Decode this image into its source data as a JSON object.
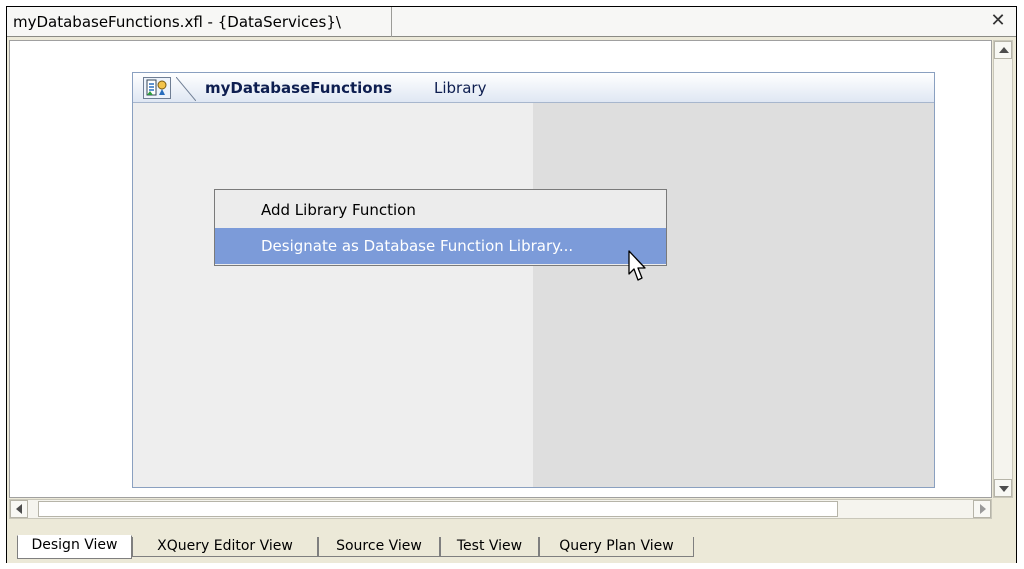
{
  "window": {
    "title": "myDatabaseFunctions.xfl - {DataServices}\\",
    "close_symbol": "✕"
  },
  "library": {
    "name": "myDatabaseFunctions",
    "type_label": "Library",
    "icon": "library-icon"
  },
  "context_menu": {
    "items": [
      {
        "label": "Add Library Function",
        "highlighted": false
      },
      {
        "label": "Designate as Database Function Library...",
        "highlighted": true
      }
    ]
  },
  "tabs": [
    {
      "label": "Design View",
      "active": true
    },
    {
      "label": "XQuery Editor View",
      "active": false
    },
    {
      "label": "Source View",
      "active": false
    },
    {
      "label": "Test View",
      "active": false
    },
    {
      "label": "Query Plan View",
      "active": false
    }
  ],
  "colors": {
    "menu_highlight": "#7c9bd9",
    "panel_header_text": "#0e1e50"
  }
}
